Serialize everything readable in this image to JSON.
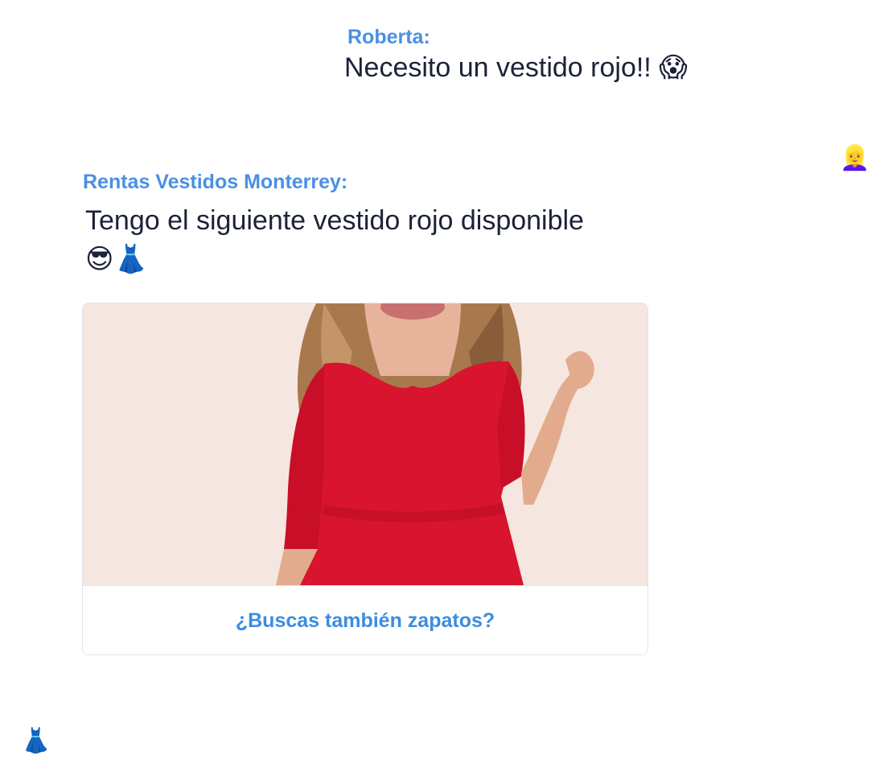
{
  "conversation": {
    "user": {
      "name": "Roberta:",
      "message": "Necesito un vestido rojo!!",
      "message_emoji": "😱",
      "avatar_emoji": "👱‍♀️"
    },
    "bot": {
      "name": "Rentas Vestidos Monterrey:",
      "message": "Tengo el siguiente vestido rojo disponible",
      "message_emojis": "😎👗",
      "avatar_emoji": "👗"
    },
    "card": {
      "image_alt": "Vestido rojo",
      "button_label": "¿Buscas también zapatos?"
    }
  },
  "colors": {
    "sender_name": "#4a90e2",
    "message_text": "#1c2237",
    "button_text": "#3b8de0",
    "dress_red": "#d8142e"
  }
}
